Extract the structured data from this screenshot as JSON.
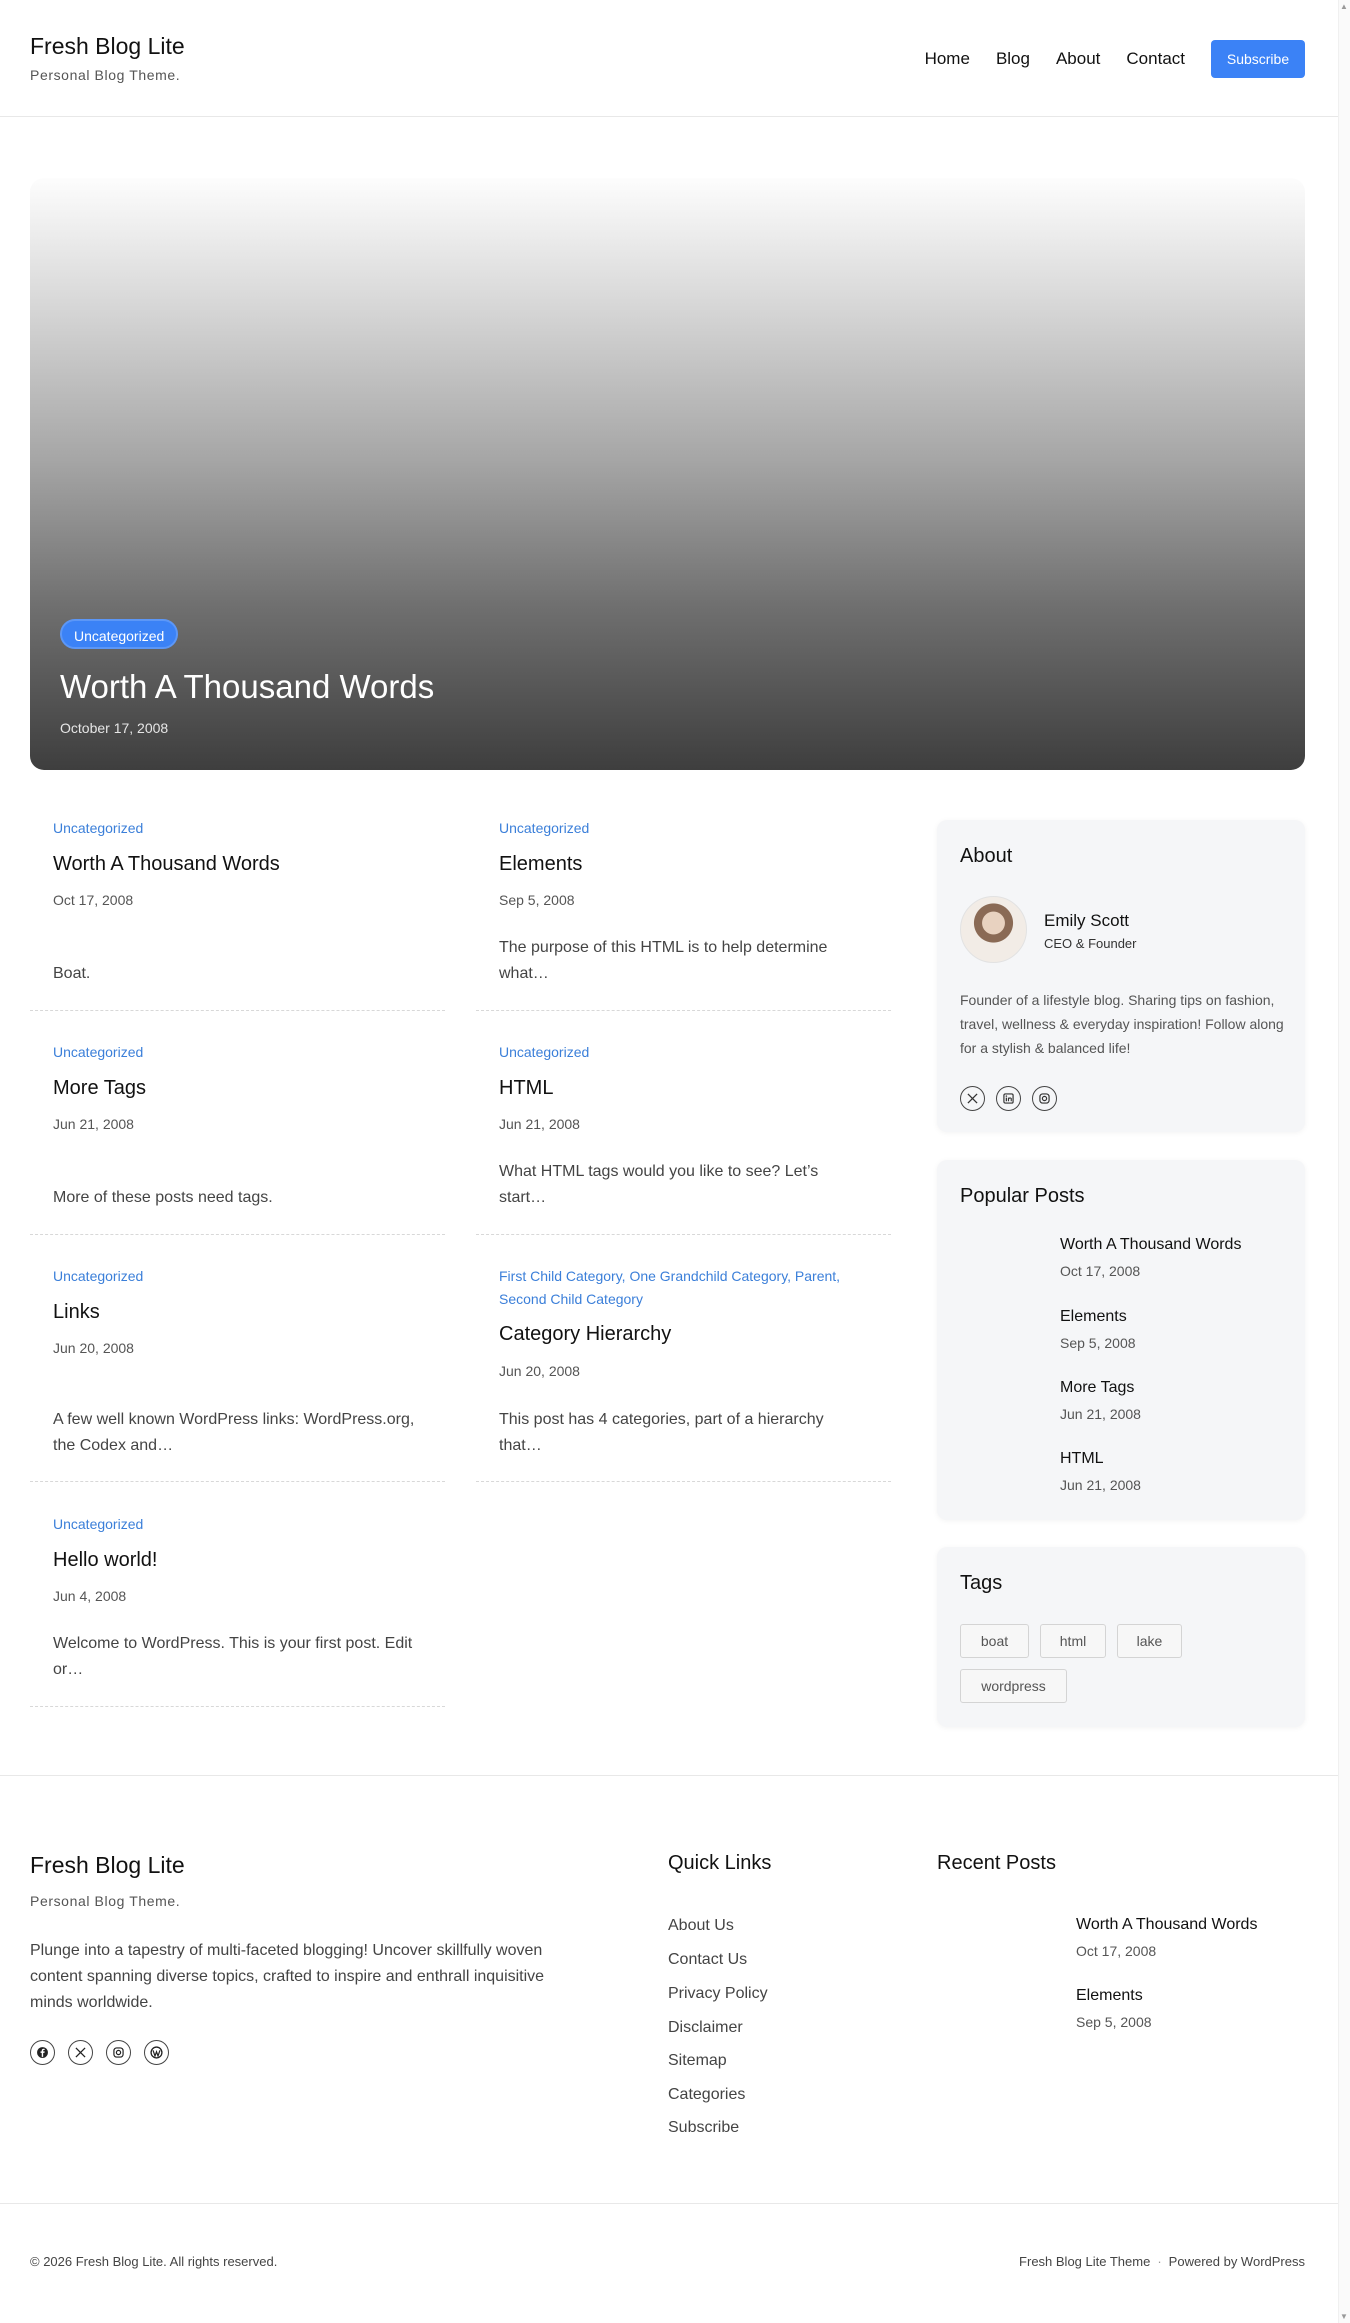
{
  "header": {
    "site_title": "Fresh Blog Lite",
    "tagline": "Personal Blog Theme.",
    "nav": [
      "Home",
      "Blog",
      "About",
      "Contact"
    ],
    "subscribe": "Subscribe"
  },
  "hero": {
    "category": "Uncategorized",
    "title": "Worth A Thousand Words",
    "date": "October 17, 2008"
  },
  "posts": [
    {
      "category": "Uncategorized",
      "title": "Worth A Thousand Words",
      "date": "Oct 17, 2008",
      "excerpt": "Boat."
    },
    {
      "category": "Uncategorized",
      "title": "Elements",
      "date": "Sep 5, 2008",
      "excerpt": "The purpose of this HTML is to help determine what…"
    },
    {
      "category": "Uncategorized",
      "title": "More Tags",
      "date": "Jun 21, 2008",
      "excerpt": "More of these posts need tags."
    },
    {
      "category": "Uncategorized",
      "title": "HTML",
      "date": "Jun 21, 2008",
      "excerpt": "What HTML tags would you like to see? Let’s start…"
    },
    {
      "category": "Uncategorized",
      "title": "Links",
      "date": "Jun 20, 2008",
      "excerpt": "A few well known WordPress links: WordPress.org, the Codex and…"
    },
    {
      "category": "First Child Category, One Grandchild Category, Parent, Second Child Category",
      "title": "Category Hierarchy",
      "date": "Jun 20, 2008",
      "excerpt": "This post has 4 categories, part of a hierarchy that…"
    },
    {
      "category": "Uncategorized",
      "title": "Hello world!",
      "date": "Jun 4, 2008",
      "excerpt": "Welcome to WordPress. This is your first post. Edit or…"
    }
  ],
  "sidebar": {
    "about": {
      "title": "About",
      "name": "Emily Scott",
      "role": "CEO & Founder",
      "bio": "Founder of a lifestyle blog. Sharing tips on fashion, travel, wellness & everyday inspiration! Follow along for a stylish & balanced life!",
      "social_icons": [
        "x-icon",
        "linkedin-icon",
        "instagram-icon"
      ]
    },
    "popular": {
      "title": "Popular Posts",
      "items": [
        {
          "title": "Worth A Thousand Words",
          "date": "Oct 17, 2008"
        },
        {
          "title": "Elements",
          "date": "Sep 5, 2008"
        },
        {
          "title": "More Tags",
          "date": "Jun 21, 2008"
        },
        {
          "title": "HTML",
          "date": "Jun 21, 2008"
        }
      ]
    },
    "tags": {
      "title": "Tags",
      "items": [
        "boat",
        "html",
        "lake",
        "wordpress"
      ]
    }
  },
  "footer": {
    "site_title": "Fresh Blog Lite",
    "tagline": "Personal Blog Theme.",
    "description": "Plunge into a tapestry of multi-faceted blogging! Uncover skillfully woven content spanning diverse topics, crafted to inspire and enthrall inquisitive minds worldwide.",
    "social_icons": [
      "facebook-icon",
      "x-icon",
      "instagram-icon",
      "wordpress-icon"
    ],
    "quick_links_title": "Quick Links",
    "quick_links": [
      "About Us",
      "Contact Us",
      "Privacy Policy",
      "Disclaimer",
      "Sitemap",
      "Categories",
      "Subscribe"
    ],
    "recent_title": "Recent Posts",
    "recent": [
      {
        "title": "Worth A Thousand Words",
        "date": "Oct 17, 2008"
      },
      {
        "title": "Elements",
        "date": "Sep 5, 2008"
      }
    ],
    "copyright": "© 2026 Fresh Blog Lite. All rights reserved.",
    "credit_theme": "Fresh Blog Lite Theme",
    "credit_powered": "Powered by WordPress"
  },
  "colors": {
    "accent": "#3b82f6",
    "category_link": "#3b7fd9",
    "widget_bg": "#f5f6f8"
  }
}
